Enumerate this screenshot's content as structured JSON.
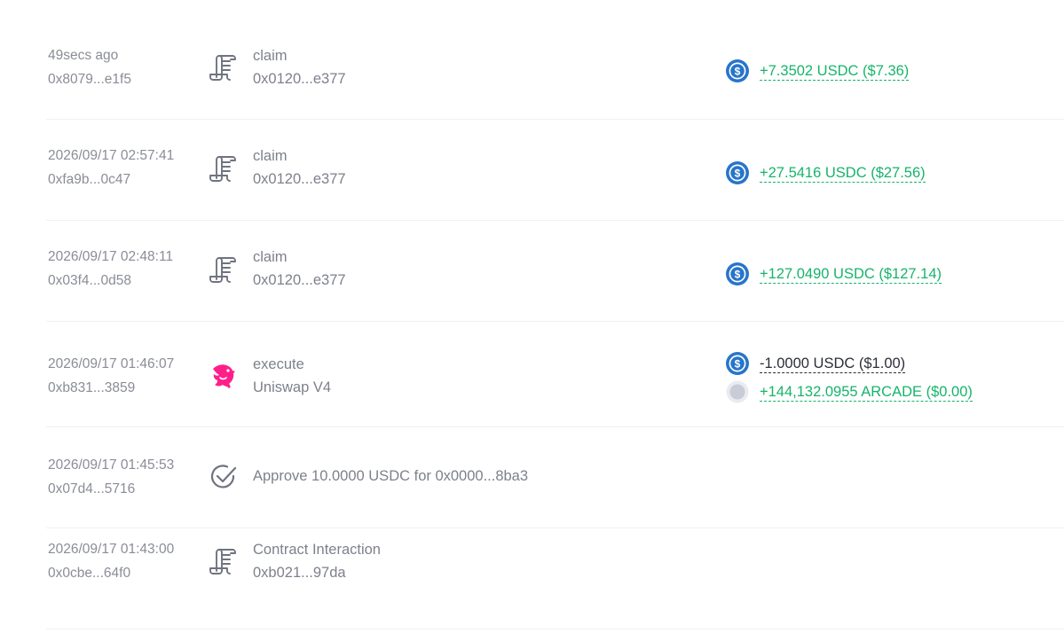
{
  "transactions": [
    {
      "time": "49secs ago",
      "hash": "0x8079...e1f5",
      "icon": "contract-scroll-icon",
      "action": "claim",
      "target": "0x0120...e377",
      "changes": [
        {
          "token_icon": "usdc-icon",
          "amount": "+7.3502 USDC ($7.36)",
          "direction": "positive"
        }
      ]
    },
    {
      "time": "2026/09/17 02:57:41",
      "hash": "0xfa9b...0c47",
      "icon": "contract-scroll-icon",
      "action": "claim",
      "target": "0x0120...e377",
      "changes": [
        {
          "token_icon": "usdc-icon",
          "amount": "+27.5416 USDC ($27.56)",
          "direction": "positive"
        }
      ]
    },
    {
      "time": "2026/09/17 02:48:11",
      "hash": "0x03f4...0d58",
      "icon": "contract-scroll-icon",
      "action": "claim",
      "target": "0x0120...e377",
      "changes": [
        {
          "token_icon": "usdc-icon",
          "amount": "+127.0490 USDC ($127.14)",
          "direction": "positive"
        }
      ]
    },
    {
      "time": "2026/09/17 01:46:07",
      "hash": "0xb831...3859",
      "icon": "uniswap-unicorn-icon",
      "action": "execute",
      "target": "Uniswap V4",
      "changes": [
        {
          "token_icon": "usdc-icon",
          "amount": "-1.0000 USDC ($1.00)",
          "direction": "negative"
        },
        {
          "token_icon": "unknown-token-icon",
          "amount": "+144,132.0955 ARCADE ($0.00)",
          "direction": "positive"
        }
      ]
    },
    {
      "time": "2026/09/17 01:45:53",
      "hash": "0x07d4...5716",
      "icon": "approve-check-icon",
      "action": "Approve 10.0000 USDC for 0x0000...8ba3",
      "target": "",
      "changes": []
    },
    {
      "time": "2026/09/17 01:43:00",
      "hash": "0x0cbe...64f0",
      "icon": "contract-scroll-icon",
      "action": "Contract Interaction",
      "target": "0xb021...97da",
      "changes": []
    }
  ],
  "colors": {
    "positive": "#16b46a",
    "negative": "#2b2e38",
    "usdc": "#2775ca",
    "muted_text": "#8a8d96",
    "uniswap_pink": "#ff007a"
  }
}
